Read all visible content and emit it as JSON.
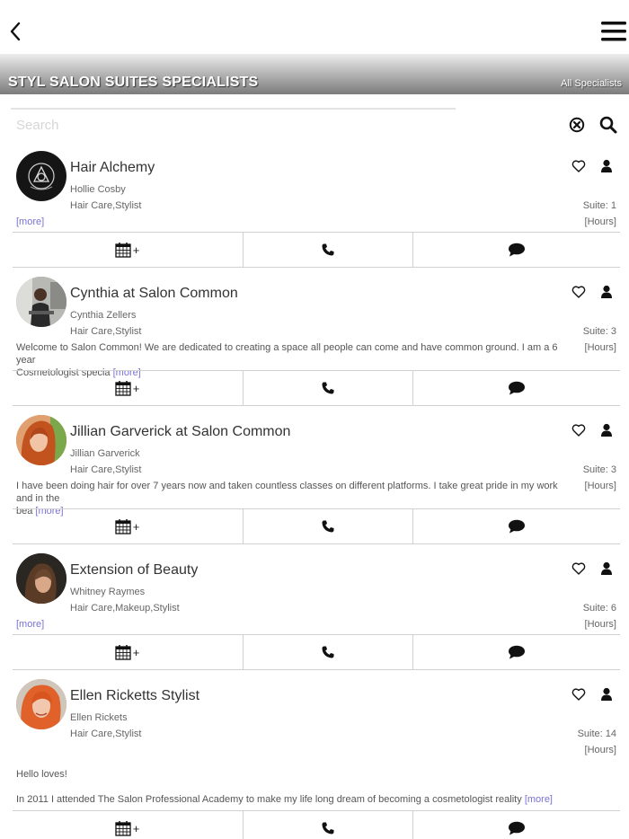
{
  "header": {
    "back_icon": "chevron-left-icon",
    "menu_icon": "hamburger-menu-icon",
    "banner_title": "STYL SALON SUITES SPECIALISTS",
    "banner_link": "All Specialists"
  },
  "search": {
    "placeholder": "Search",
    "value": ""
  },
  "more_label": "[more]",
  "specialists": [
    {
      "name": "Hair Alchemy",
      "person": "Hollie Cosby",
      "categories": "Hair Care,Stylist",
      "suite": "Suite: 1",
      "hours": "[Hours]",
      "description": "",
      "more": "[more]"
    },
    {
      "name": "Cynthia at Salon Common",
      "person": "Cynthia Zellers",
      "categories": "Hair Care,Stylist",
      "suite": "Suite: 3",
      "hours": "[Hours]",
      "description_line1": "Welcome to Salon Common! We are dedicated to creating a space all people can come and have common ground. I am a 6 year",
      "description_line2": "Cosmetologist specia",
      "more": "[more]"
    },
    {
      "name": "Jillian Garverick at Salon Common",
      "person": "Jillian Garverick",
      "categories": "Hair Care,Stylist",
      "suite": "Suite: 3",
      "hours": "[Hours]",
      "description_line1": "I have been doing hair for over 7 years now and taken countless classes on different platforms. I take great pride in my work and in the",
      "description_line2": "bea",
      "more": "[more]"
    },
    {
      "name": "Extension of Beauty",
      "person": "Whitney Raymes",
      "categories": "Hair Care,Makeup,Stylist",
      "suite": "Suite: 6",
      "hours": "[Hours]",
      "description": "",
      "more": "[more]"
    },
    {
      "name": "Ellen Ricketts Stylist",
      "person": "Ellen Rickets",
      "categories": "Hair Care,Stylist",
      "suite": "Suite: 14",
      "hours": "[Hours]",
      "greeting": "Hello loves!",
      "description_line1": "In 2011 I attended The Salon Professional Academy to make my life long dream of becoming a cosmetologist reality",
      "more": "[more]"
    }
  ],
  "action_icons": {
    "book": "calendar-plus-icon",
    "call": "phone-icon",
    "message": "chat-bubble-icon",
    "favorite": "heart-outline-icon",
    "profile": "person-icon"
  },
  "colors": {
    "link": "#7b72d6",
    "banner_top": "#ededed",
    "banner_bottom": "#7b7b7b"
  }
}
